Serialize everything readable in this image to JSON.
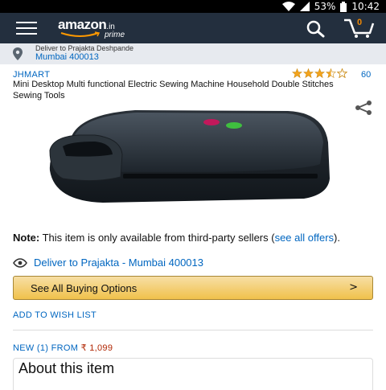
{
  "status_bar": {
    "battery": "53%",
    "time": "10:42"
  },
  "app_bar": {
    "logo_word": "amazon",
    "logo_tld": ".in",
    "logo_sub": "prime",
    "cart_count": "0",
    "icons": [
      "menu-icon",
      "search-icon",
      "cart-icon"
    ]
  },
  "delivery_bar": {
    "line1": "Deliver to Prajakta Deshpande",
    "line2": "Mumbai 400013"
  },
  "product": {
    "brand": "JHMART",
    "rating_stars": 3.5,
    "rating_count": "60",
    "title": "Mini Desktop Multi functional Electric Sewing Machine Household Double Stitches Sewing Tools"
  },
  "note": {
    "label": "Note:",
    "text": " This item is only available from third-party sellers (",
    "link": "see all offers",
    "after": ")."
  },
  "deliver_link": "Deliver to Prajakta - Mumbai 400013",
  "buying_options": {
    "label": "See All Buying Options",
    "arrow": ">"
  },
  "wishlist": "ADD TO WISH LIST",
  "offers": {
    "label": "NEW (1) FROM",
    "price": "₹ 1,099"
  },
  "about": {
    "heading": "About this item"
  },
  "colors": {
    "app_bar": "#232f3e",
    "link": "#0066c0",
    "price": "#b12704",
    "button": "#f0c14b",
    "star": "#f4a41c"
  }
}
